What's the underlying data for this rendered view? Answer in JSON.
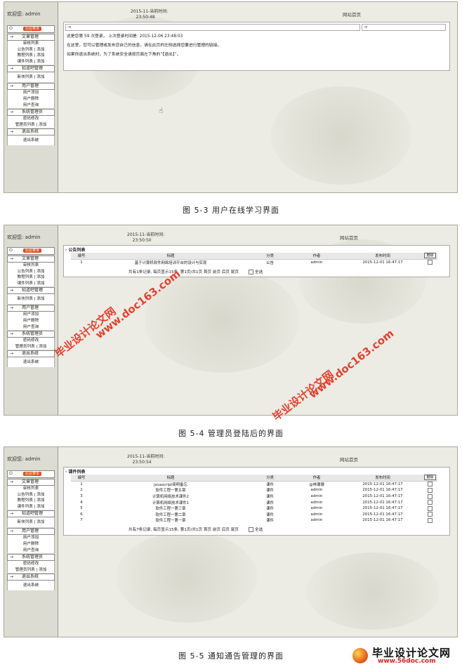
{
  "common": {
    "welcome": "欢迎您: admin",
    "home_link": "网站首页",
    "menu_badge": "后台菜单",
    "menu": {
      "article": "文章管理",
      "audit_list": "审核列表",
      "notice_row": "公告列表 | 添加",
      "tutorial_row": "教程列表 | 添加",
      "courseware_row": "课件列表 | 添加",
      "knowledge": "知道吧管理",
      "news_row": "新块列表 | 添加",
      "user": "用户管理",
      "user_add": "用户添加",
      "user_delete": "用户删除",
      "user_query": "用户查询",
      "sysadmin": "系统管理员",
      "password": "密码修改",
      "admin_row": "管理员列表 | 添加",
      "exit": "退出系统",
      "exit_item": "退出系统"
    },
    "select_all": "全选",
    "delete_btn": "删除"
  },
  "shot1": {
    "time_label": "2015-11-当前时间:",
    "time_value": "23:50:48",
    "line1": "这是您第 59 次登录，  上次登录时间是:  2015-12-06 23:48:03",
    "line2": "在这里，您可以管理或发布您自己的信息，请在此页的左侧选择您要进行管理的链接。",
    "line3": "如果你退出系统时，为了系统安全请按页面左下角的“【退出】”。",
    "caption": "图 5-3   用户在线学习界面"
  },
  "shot2": {
    "time_label": "2015-11-当前时间:",
    "time_value": "23:50:50",
    "panel_title": "· 公告列表",
    "headers": [
      "编号",
      "标题",
      "分类",
      "作者",
      "发布时间"
    ],
    "rows": [
      {
        "id": "1",
        "title": "基于计算机软件网络培训平台的设计与实现",
        "cat": "公告",
        "author": "admin",
        "time": "2015-12-01 16:47:17"
      }
    ],
    "pager": "共有1条记录,  每页显示15条,  第1页/共1页 首页 前页 后页 尾页",
    "caption": "图 5-4   管理员登陆后的界面"
  },
  "shot3": {
    "time_label": "2015-11-当前时间:",
    "time_value": "23:50:54",
    "panel_title": "· 课件列表",
    "headers": [
      "编号",
      "标题",
      "分类",
      "作者",
      "发布时间"
    ],
    "rows": [
      {
        "id": "1",
        "title": "javascript简明备忘",
        "cat": "课件",
        "author": "@林珊珊",
        "time": "2015-12-01 16:47:17"
      },
      {
        "id": "2",
        "title": "软件工程一第五章",
        "cat": "课件",
        "author": "admin",
        "time": "2015-12-01 16:47:17"
      },
      {
        "id": "3",
        "title": "计算机网络技术课件2",
        "cat": "课件",
        "author": "admin",
        "time": "2015-12-01 16:47:17"
      },
      {
        "id": "4",
        "title": "计算机网络技术课件1",
        "cat": "课件",
        "author": "admin",
        "time": "2015-12-01 16:47:17"
      },
      {
        "id": "5",
        "title": "软件工程一第三章",
        "cat": "课件",
        "author": "admin",
        "time": "2015-12-01 16:47:17"
      },
      {
        "id": "6",
        "title": "软件工程一第二章",
        "cat": "课件",
        "author": "admin",
        "time": "2015-12-01 16:47:17"
      },
      {
        "id": "7",
        "title": "软件工程一第一章",
        "cat": "课件",
        "author": "admin",
        "time": "2015-12-01 16:47:17"
      }
    ],
    "pager": "共有7条记录,  每页显示15条,  第1页/共1页 首页 前页 后页 尾页",
    "caption": "图 5-5   通知通告管理的界面"
  },
  "watermarks": {
    "brand": "毕业设计论文网",
    "url": "www.doc163.com",
    "logo_text": "毕业设计论文网",
    "logo_url": "www.56doc.com"
  },
  "colors": {
    "watermark": "#e8321f",
    "menu_badge": "#e3481f"
  }
}
